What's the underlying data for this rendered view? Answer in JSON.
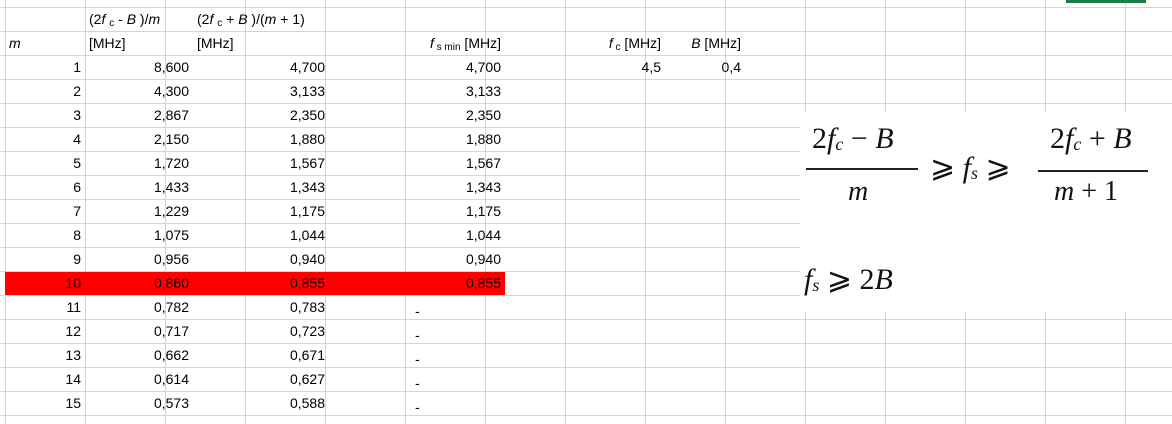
{
  "headers": {
    "m": "m",
    "col_a": {
      "line1": "(2f c - B )/m",
      "line2": "[MHz]"
    },
    "col_b": {
      "line1": "(2f c + B )/(m + 1)",
      "line2": "[MHz]"
    },
    "fs_min": "f s min [MHz]",
    "fc": "f c [MHz]",
    "B": "B [MHz]"
  },
  "params": {
    "fc": "4,5",
    "B": "0,4"
  },
  "rows": [
    {
      "m": "1",
      "a": "8,600",
      "b": "4,700",
      "fs": "4,700"
    },
    {
      "m": "2",
      "a": "4,300",
      "b": "3,133",
      "fs": "3,133"
    },
    {
      "m": "3",
      "a": "2,867",
      "b": "2,350",
      "fs": "2,350"
    },
    {
      "m": "4",
      "a": "2,150",
      "b": "1,880",
      "fs": "1,880"
    },
    {
      "m": "5",
      "a": "1,720",
      "b": "1,567",
      "fs": "1,567"
    },
    {
      "m": "6",
      "a": "1,433",
      "b": "1,343",
      "fs": "1,343"
    },
    {
      "m": "7",
      "a": "1,229",
      "b": "1,175",
      "fs": "1,175"
    },
    {
      "m": "8",
      "a": "1,075",
      "b": "1,044",
      "fs": "1,044"
    },
    {
      "m": "9",
      "a": "0,956",
      "b": "0,940",
      "fs": "0,940"
    },
    {
      "m": "10",
      "a": "0,860",
      "b": "0,855",
      "fs": "0,855",
      "highlight": true
    },
    {
      "m": "11",
      "a": "0,782",
      "b": "0,783",
      "fs": "-"
    },
    {
      "m": "12",
      "a": "0,717",
      "b": "0,723",
      "fs": "-"
    },
    {
      "m": "13",
      "a": "0,662",
      "b": "0,671",
      "fs": "-"
    },
    {
      "m": "14",
      "a": "0,614",
      "b": "0,627",
      "fs": "-"
    },
    {
      "m": "15",
      "a": "0,573",
      "b": "0,588",
      "fs": "-"
    }
  ],
  "formula": {
    "numerator_left": "2fc − B",
    "denominator_left": "m",
    "middle": "≥ fs ≥",
    "numerator_right": "2fc + B",
    "denominator_right": "m + 1",
    "nyquist": "fs ≥ 2B"
  },
  "colors": {
    "highlight": "#ff0000",
    "grid": "#d4d4d4"
  }
}
